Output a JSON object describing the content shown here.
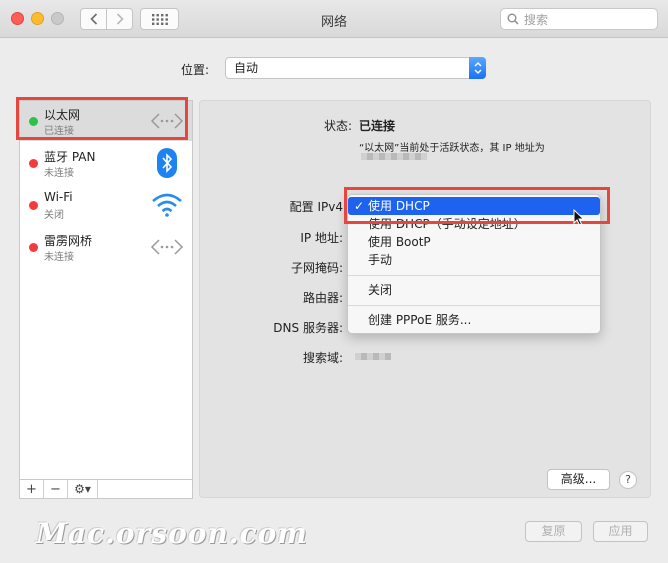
{
  "window": {
    "title": "网络"
  },
  "search": {
    "placeholder": "搜索"
  },
  "location": {
    "label": "位置:",
    "value": "自动"
  },
  "services": [
    {
      "name": "以太网",
      "status": "已连接",
      "state": "green",
      "icon": "ethernet-arrows-icon"
    },
    {
      "name": "蓝牙 PAN",
      "status": "未连接",
      "state": "red",
      "icon": "bluetooth-icon"
    },
    {
      "name": "Wi-Fi",
      "status": "关闭",
      "state": "red",
      "icon": "wifi-icon"
    },
    {
      "name": "雷雳网桥",
      "status": "未连接",
      "state": "red",
      "icon": "thunderbolt-bridge-arrows-icon"
    }
  ],
  "sidebar_footer": {
    "add": "+",
    "remove": "−",
    "gear": "⚙︎▾"
  },
  "detail": {
    "status_label": "状态:",
    "status_value": "已连接",
    "status_desc": "“以太网”当前处于活跃状态，其 IP 地址为",
    "configure_label": "配置 IPv4",
    "ip_label": "IP 地址:",
    "subnet_label": "子网掩码:",
    "router_label": "路由器:",
    "dns_label": "DNS 服务器:",
    "search_domain_label": "搜索域:"
  },
  "ipv4_menu": {
    "items": [
      {
        "label": "使用 DHCP",
        "selected": true
      },
      {
        "label": "使用 DHCP（手动设定地址）",
        "selected": false
      },
      {
        "label": "使用 BootP",
        "selected": false
      },
      {
        "label": "手动",
        "selected": false
      },
      {
        "label": "关闭",
        "selected": false
      },
      {
        "label": "创建 PPPoE 服务...",
        "selected": false
      }
    ],
    "check": "✓"
  },
  "buttons": {
    "advanced": "高级...",
    "help": "?",
    "revert": "复原",
    "apply": "应用"
  },
  "watermark": "Mac.orsoon.com",
  "colors": {
    "accent": "#1d63f0",
    "highlight_box": "#e5473f",
    "connected": "#2ec14a",
    "disconnected": "#f23c3c"
  }
}
